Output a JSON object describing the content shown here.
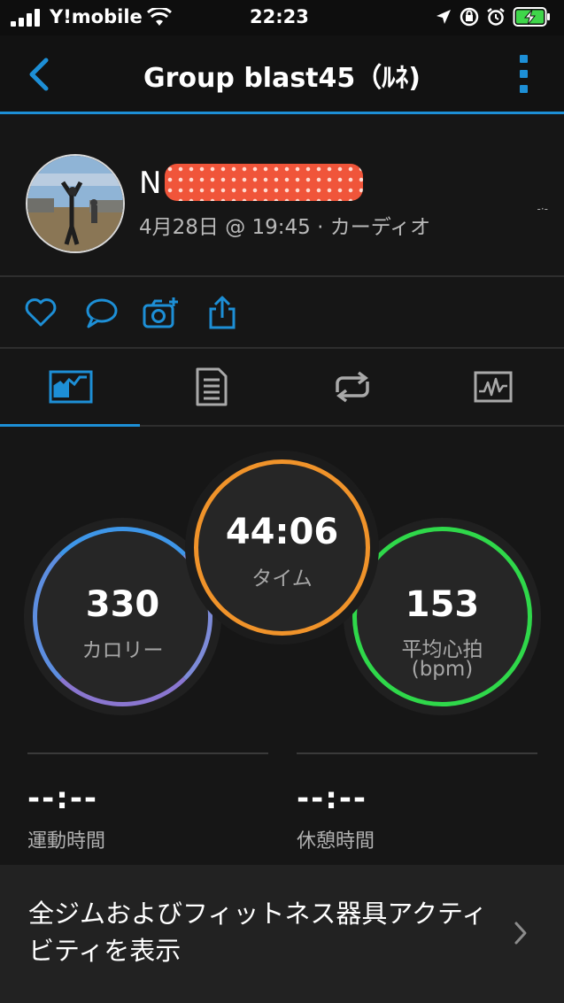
{
  "status_bar": {
    "carrier": "Y!mobile",
    "time": "22:23"
  },
  "navbar": {
    "title": "Group blast45（ﾙﾈ)"
  },
  "user": {
    "name_visible": "N",
    "meta": "4月28日 @ 19:45 · カーディオ",
    "side_mark": "-·-"
  },
  "stats": {
    "calories": {
      "value": "330",
      "label": "カロリー"
    },
    "time": {
      "value": "44:06",
      "label": "タイム"
    },
    "heart_rate": {
      "value": "153",
      "label": "平均心拍",
      "unit": "(bpm)"
    }
  },
  "metrics": {
    "exercise_time": {
      "value": "--:--",
      "label": "運動時間"
    },
    "rest_time": {
      "value": "--:--",
      "label": "休憩時間"
    }
  },
  "gym_link": {
    "label": "全ジムおよびフィットネス器具アクティビティを表示"
  },
  "colors": {
    "accent": "#1d8fd6",
    "time_ring": "#f0932a",
    "hr_ring": "#2fd84a",
    "cal_ring": "#7d8bd8"
  },
  "icons": {
    "actions": [
      "heart-icon",
      "comment-icon",
      "add-photo-icon",
      "share-icon"
    ],
    "tabs": [
      "stats-tab-icon",
      "details-tab-icon",
      "laps-tab-icon",
      "chart-tab-icon"
    ]
  }
}
